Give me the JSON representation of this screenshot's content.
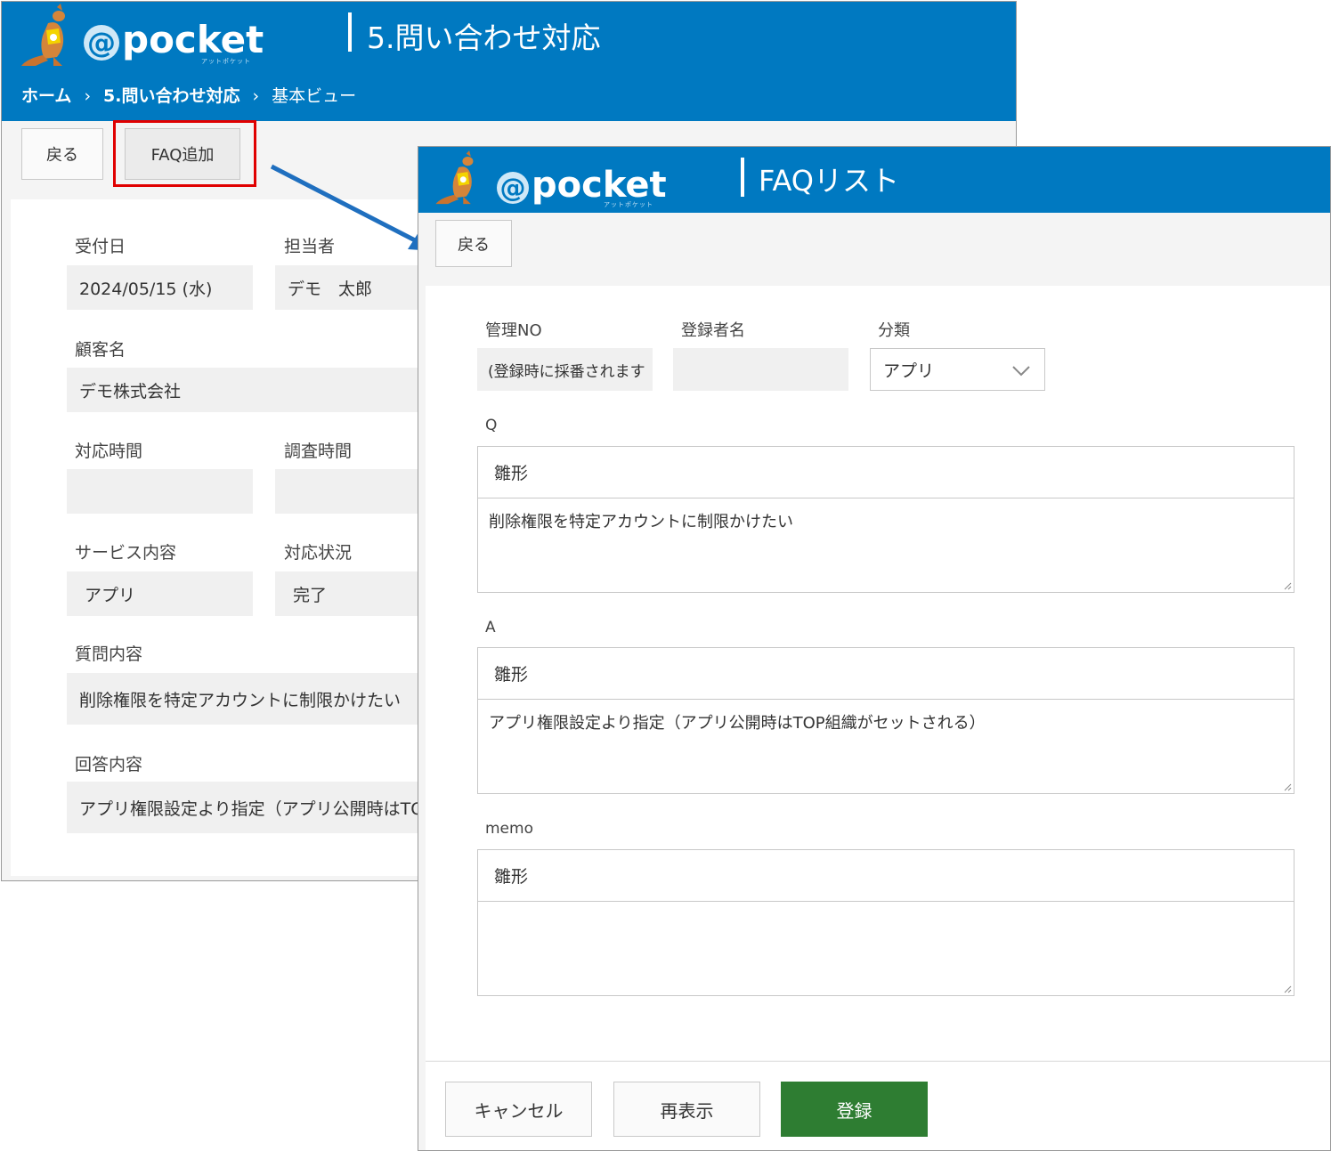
{
  "colors": {
    "brand_blue": "#0079c1",
    "register_green": "#2e7d32",
    "highlight_red": "#e00000",
    "arrow_blue": "#1f6fbf"
  },
  "back_window": {
    "logo": {
      "text": "pocket",
      "at": "@",
      "kana": "アットポケット"
    },
    "title": "5.問い合わせ対応",
    "breadcrumb": [
      "ホーム",
      "5.問い合わせ対応",
      "基本ビュー"
    ],
    "breadcrumb_sep": "›",
    "buttons": {
      "back": "戻る",
      "faq_add": "FAQ追加"
    },
    "fields": {
      "received_date": {
        "label": "受付日",
        "value": "2024/05/15 (水)"
      },
      "assignee": {
        "label": "担当者",
        "value": "デモ　太郎"
      },
      "customer": {
        "label": "顧客名",
        "value": "デモ株式会社"
      },
      "response_time": {
        "label": "対応時間",
        "value": ""
      },
      "survey_time": {
        "label": "調査時間",
        "value": ""
      },
      "service": {
        "label": "サービス内容",
        "value": "アプリ"
      },
      "status": {
        "label": "対応状況",
        "value": "完了"
      },
      "question": {
        "label": "質問内容",
        "value": "削除権限を特定アカウントに制限かけたい"
      },
      "answer": {
        "label": "回答内容",
        "value": "アプリ権限設定より指定（アプリ公開時はTO"
      }
    }
  },
  "front_window": {
    "logo": {
      "text": "pocket",
      "at": "@",
      "kana": "アットポケット"
    },
    "title": "FAQリスト",
    "buttons": {
      "back": "戻る",
      "cancel": "キャンセル",
      "redisplay": "再表示",
      "register": "登録"
    },
    "fields": {
      "mgmt_no": {
        "label": "管理NO",
        "value": "(登録時に採番されます"
      },
      "registrant": {
        "label": "登録者名",
        "value": ""
      },
      "category": {
        "label": "分類",
        "value": "アプリ"
      }
    },
    "q": {
      "label": "Q",
      "template": "雛形",
      "text": "削除権限を特定アカウントに制限かけたい"
    },
    "a": {
      "label": "A",
      "template": "雛形",
      "text": "アプリ権限設定より指定（アプリ公開時はTOP組織がセットされる）"
    },
    "memo": {
      "label": "memo",
      "template": "雛形",
      "text": ""
    }
  }
}
